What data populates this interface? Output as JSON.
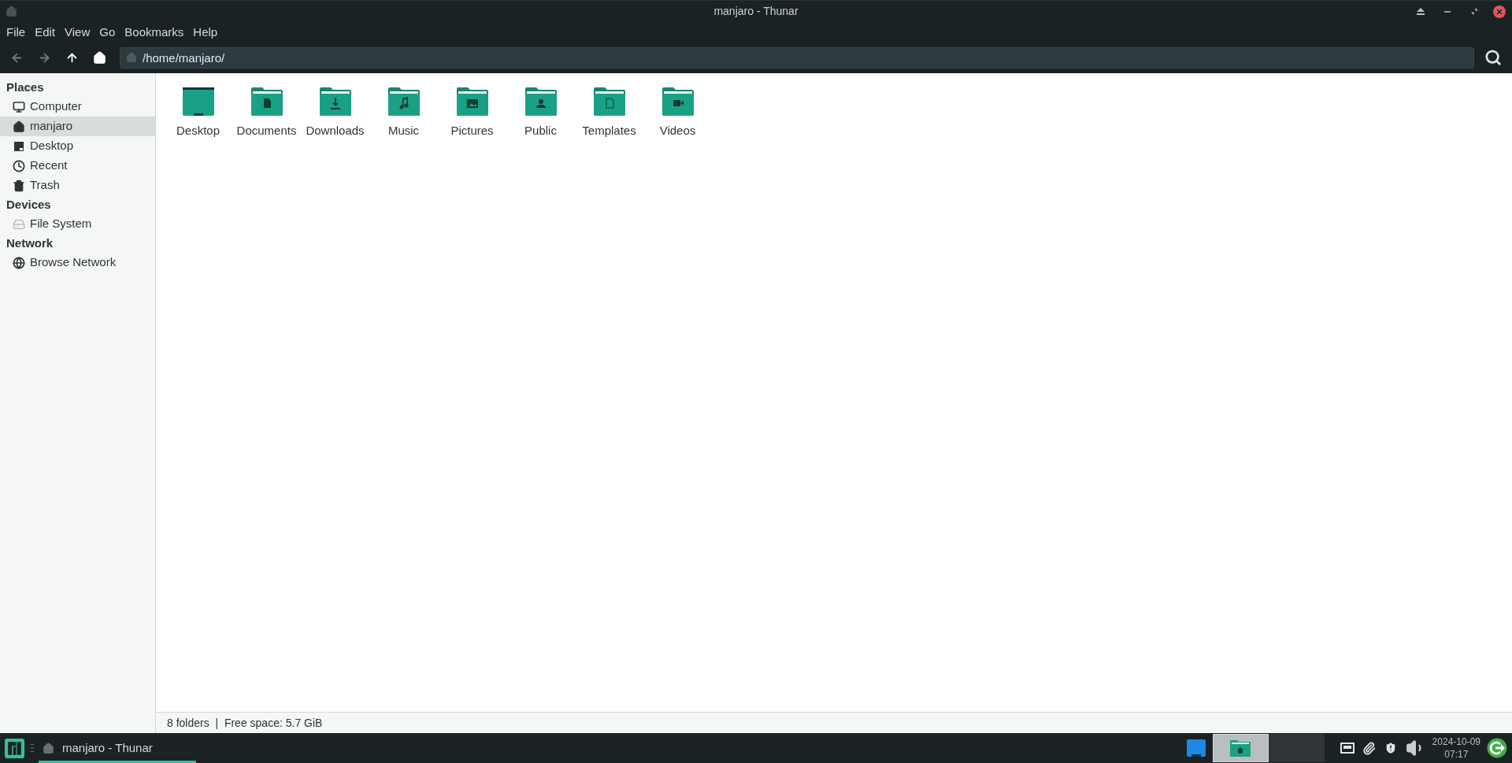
{
  "window": {
    "title": "manjaro - Thunar"
  },
  "menu": [
    "File",
    "Edit",
    "View",
    "Go",
    "Bookmarks",
    "Help"
  ],
  "toolbar": [
    {
      "kind": "back",
      "disabled": true
    },
    {
      "kind": "forward",
      "disabled": true
    },
    {
      "kind": "up",
      "disabled": false
    },
    {
      "kind": "home",
      "disabled": false
    }
  ],
  "location": {
    "value": "/home/manjaro/"
  },
  "sidebar": [
    {
      "heading": "Places",
      "items": [
        {
          "kind": "computer",
          "label": "Computer",
          "selected": false,
          "disabled": false
        },
        {
          "kind": "home",
          "label": "manjaro",
          "selected": true,
          "disabled": false
        },
        {
          "kind": "desktop",
          "label": "Desktop",
          "selected": false,
          "disabled": false
        },
        {
          "kind": "recent",
          "label": "Recent",
          "selected": false,
          "disabled": false
        },
        {
          "kind": "trash",
          "label": "Trash",
          "selected": false,
          "disabled": false
        }
      ]
    },
    {
      "heading": "Devices",
      "items": [
        {
          "kind": "drive",
          "label": "File System",
          "selected": false,
          "disabled": true
        }
      ]
    },
    {
      "heading": "Network",
      "items": [
        {
          "kind": "network",
          "label": "Browse Network",
          "selected": false,
          "disabled": false
        }
      ]
    }
  ],
  "folders": [
    {
      "kind": "desktop",
      "label": "Desktop"
    },
    {
      "kind": "documents",
      "label": "Documents"
    },
    {
      "kind": "downloads",
      "label": "Downloads"
    },
    {
      "kind": "music",
      "label": "Music"
    },
    {
      "kind": "pictures",
      "label": "Pictures"
    },
    {
      "kind": "public",
      "label": "Public"
    },
    {
      "kind": "templates",
      "label": "Templates"
    },
    {
      "kind": "videos",
      "label": "Videos"
    }
  ],
  "status_bar": "8 folders  |  Free space: 5.7 GiB",
  "taskbar": {
    "window_button": {
      "label": "manjaro - Thunar",
      "active": true
    },
    "workspaces": [
      {
        "selected": true
      },
      {
        "selected": false
      }
    ],
    "clock": {
      "date": "2024-10-09",
      "time": "07:17"
    }
  }
}
